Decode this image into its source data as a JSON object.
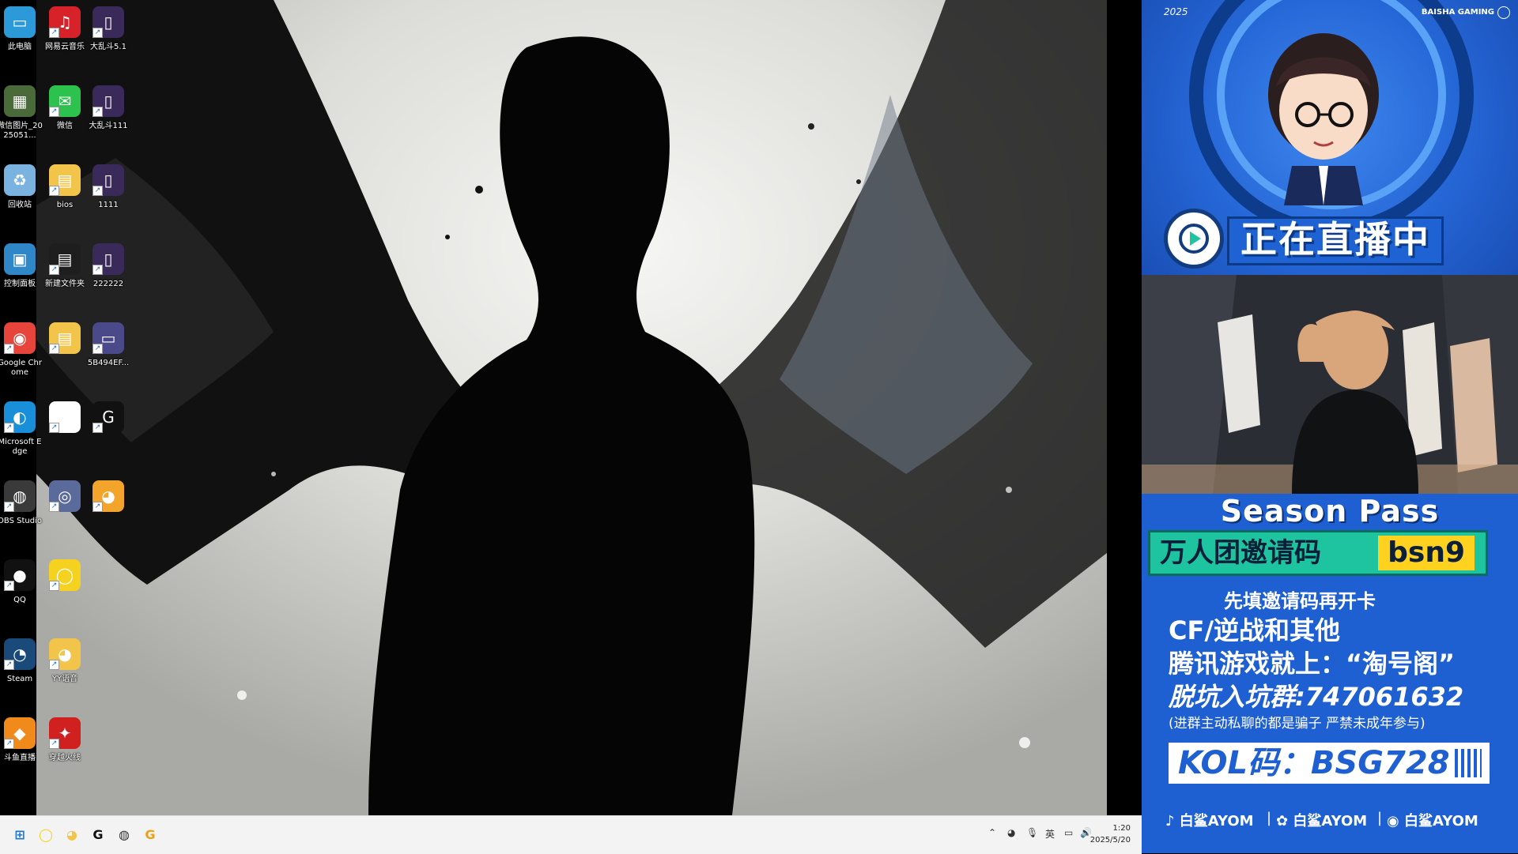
{
  "desktop": {
    "icons": [
      {
        "id": "this-pc",
        "label": "此电脑",
        "glyph": "▭",
        "color": "#2c9ad8",
        "icon": "monitor-icon"
      },
      {
        "id": "wechat-images",
        "label": "微信图片_2025051...",
        "glyph": "▦",
        "color": "#4a6a3a",
        "icon": "image-file-icon"
      },
      {
        "id": "recycle-bin",
        "label": "回收站",
        "glyph": "♻",
        "color": "#7ab3e0",
        "icon": "recycle-bin-icon"
      },
      {
        "id": "control-panel",
        "label": "控制面板",
        "glyph": "▣",
        "color": "#2f87c7",
        "icon": "control-panel-icon"
      },
      {
        "id": "google-chrome",
        "label": "Google Chrome",
        "glyph": "◉",
        "color": "#e7453b",
        "icon": "chrome-icon"
      },
      {
        "id": "microsoft-edge",
        "label": "Microsoft Edge",
        "glyph": "◐",
        "color": "#1a8fd9",
        "icon": "edge-icon"
      },
      {
        "id": "obs-studio",
        "label": "OBS Studio",
        "glyph": "◍",
        "color": "#3a3a3a",
        "icon": "obs-icon"
      },
      {
        "id": "qq",
        "label": "QQ",
        "glyph": "●",
        "color": "#111",
        "icon": "qq-penguin-icon"
      },
      {
        "id": "steam",
        "label": "Steam",
        "glyph": "◔",
        "color": "#1a4a7a",
        "icon": "steam-icon"
      },
      {
        "id": "douyu",
        "label": "斗鱼直播",
        "glyph": "◆",
        "color": "#f08a1a",
        "icon": "douyu-fish-icon"
      },
      {
        "id": "netease-music",
        "label": "网易云音乐",
        "glyph": "♫",
        "color": "#d8222a",
        "icon": "netease-music-icon"
      },
      {
        "id": "wechat",
        "label": "微信",
        "glyph": "✉",
        "color": "#2dc24e",
        "icon": "wechat-icon"
      },
      {
        "id": "bios",
        "label": "bios",
        "glyph": "▤",
        "color": "#f2c54a",
        "icon": "folder-icon"
      },
      {
        "id": "new-folder",
        "label": "新建文件夹",
        "glyph": "▤",
        "color": "#1e1e1e",
        "icon": "folder-icon"
      },
      {
        "id": "folder-5",
        "label": "",
        "glyph": "▤",
        "color": "#f2c54a",
        "icon": "folder-icon"
      },
      {
        "id": "file-6",
        "label": "",
        "glyph": "▯",
        "color": "#ffffff",
        "icon": "text-file-icon"
      },
      {
        "id": "app-7",
        "label": "",
        "glyph": "◎",
        "color": "#5a6a9a",
        "icon": "swirl-app-icon"
      },
      {
        "id": "app-8",
        "label": "",
        "glyph": "◯",
        "color": "#f5d21f",
        "icon": "ring-app-icon"
      },
      {
        "id": "yy-voice",
        "label": "YY语音",
        "glyph": "◕",
        "color": "#f2c54a",
        "icon": "raccoon-app-icon"
      },
      {
        "id": "crossfire",
        "label": "穿越火线",
        "glyph": "✦",
        "color": "#d02020",
        "icon": "crossfire-icon"
      },
      {
        "id": "dld-51",
        "label": "大乱斗5.1",
        "glyph": "▯",
        "color": "#3a2a5a",
        "icon": "game-file-icon"
      },
      {
        "id": "dld-111",
        "label": "大乱斗111",
        "glyph": "▯",
        "color": "#3a2a5a",
        "icon": "game-file-icon"
      },
      {
        "id": "file-1111",
        "label": "1111",
        "glyph": "▯",
        "color": "#3a2a5a",
        "icon": "game-file-icon"
      },
      {
        "id": "file-222222",
        "label": "222222",
        "glyph": "▯",
        "color": "#3a2a5a",
        "icon": "game-file-icon"
      },
      {
        "id": "file-5b",
        "label": "5B494EF...",
        "glyph": "▭",
        "color": "#4a4a8a",
        "icon": "image-file-icon"
      },
      {
        "id": "logitech-g",
        "label": "",
        "glyph": "G",
        "color": "#111",
        "icon": "logitech-g-icon"
      },
      {
        "id": "raccoon-2",
        "label": "",
        "glyph": "◕",
        "color": "#f2a52a",
        "icon": "raccoon-app-icon"
      }
    ]
  },
  "taskbar": {
    "apps": [
      {
        "id": "start",
        "glyph": "⊞",
        "color": "#1a74d8",
        "icon": "windows-start-icon"
      },
      {
        "id": "ring-app",
        "glyph": "◯",
        "color": "#f5d21f",
        "icon": "ring-app-icon"
      },
      {
        "id": "raccoon-app",
        "glyph": "◕",
        "color": "#f2c54a",
        "icon": "raccoon-app-icon"
      },
      {
        "id": "logitech",
        "glyph": "G",
        "color": "#111",
        "icon": "logitech-g-icon"
      },
      {
        "id": "obs",
        "glyph": "◍",
        "color": "#333",
        "icon": "obs-icon"
      },
      {
        "id": "g-hub",
        "glyph": "G",
        "color": "#e8a21a",
        "icon": "g-hub-icon"
      }
    ],
    "tray": {
      "ime": "英",
      "time": "1:20",
      "date": "2025/5/20"
    }
  },
  "overlay": {
    "year": "2025",
    "brand": "BAISHA GAMING",
    "live_text": "正在直播中",
    "season_title": "Season Pass",
    "invite_label": "万人团邀请码",
    "invite_code": "bsn9",
    "line1": "先填邀请码再开卡",
    "line2": "CF/逆战和其他",
    "line3": "腾讯游戏就上：“淘号阁”",
    "line4": "脱坑入坑群:747061632",
    "line5": "(进群主动私聊的都是骗子 严禁未成年参与)",
    "kol": "KOL码：BSG728",
    "socials": [
      {
        "platform": "douyin",
        "icon": "douyin-icon",
        "glyph": "♪",
        "handle": "白鲨AYOM"
      },
      {
        "platform": "kuaishou",
        "icon": "kuaishou-icon",
        "glyph": "✿",
        "handle": "白鲨AYOM"
      },
      {
        "platform": "weibo",
        "icon": "weibo-icon",
        "glyph": "◉",
        "handle": "白鲨AYOM"
      }
    ],
    "colors": {
      "accent": "#1e5fd1",
      "invite_bg": "#1ec4a0",
      "invite_code_bg": "#ffd21f"
    }
  }
}
